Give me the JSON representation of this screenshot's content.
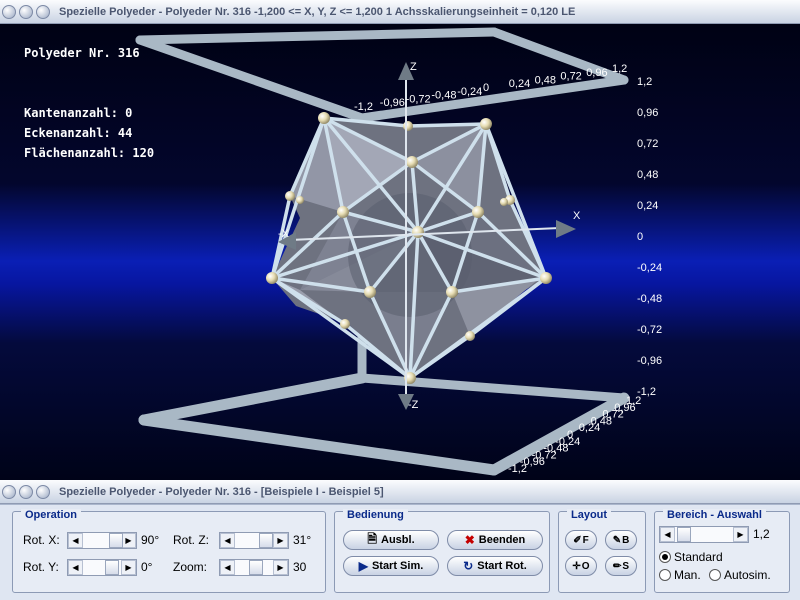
{
  "window": {
    "title_top": "Spezielle Polyeder - Polyeder Nr. 316   -1,200 <= X, Y, Z <= 1,200    1 Achsskalierungseinheit = 0,120 LE",
    "title_bottom": "Spezielle Polyeder - Polyeder Nr. 316 - [Beispiele I - Beispiel 5]"
  },
  "viewport": {
    "polyeder_label": "Polyeder Nr. 316",
    "kanten": "Kantenanzahl: 0",
    "ecken": "Eckenanzahl: 44",
    "flaechen": "Flächenanzahl: 120",
    "axes": {
      "z_pos": "Z",
      "z_neg": "-Z",
      "x_pos": "X",
      "x_neg": "-X"
    },
    "top_ticks": [
      "-1,2",
      "-0,96",
      "-0,72",
      "-0,48",
      "-0,24",
      "0",
      "0,24",
      "0,48",
      "0,72",
      "0,96",
      "1,2"
    ],
    "right_ticks": [
      "1,2",
      "0,96",
      "0,72",
      "0,48",
      "0,24",
      "0",
      "-0,24",
      "-0,48",
      "-0,72",
      "-0,96",
      "-1,2"
    ],
    "bottom_ticks": [
      "-1,2",
      "-0,96",
      "-0,72",
      "-0,48",
      "-0,24",
      "0",
      "0,24",
      "0,48",
      "0,72",
      "0,96",
      "1,2"
    ]
  },
  "panel": {
    "operation": {
      "title": "Operation",
      "rot_x_label": "Rot. X:",
      "rot_x_value": "90°",
      "rot_y_label": "Rot. Y:",
      "rot_y_value": "0°",
      "rot_z_label": "Rot. Z:",
      "rot_z_value": "31°",
      "zoom_label": "Zoom:",
      "zoom_value": "30"
    },
    "bedienung": {
      "title": "Bedienung",
      "ausbl": "Ausbl.",
      "beenden": "Beenden",
      "start_sim": "Start Sim.",
      "start_rot": "Start Rot."
    },
    "layout": {
      "title": "Layout",
      "f": "F",
      "b": "B",
      "o": "O",
      "s": "S"
    },
    "bereich": {
      "title": "Bereich - Auswahl",
      "value": "1,2",
      "standard": "Standard",
      "man": "Man.",
      "autosim": "Autosim.",
      "selected": "standard"
    }
  }
}
